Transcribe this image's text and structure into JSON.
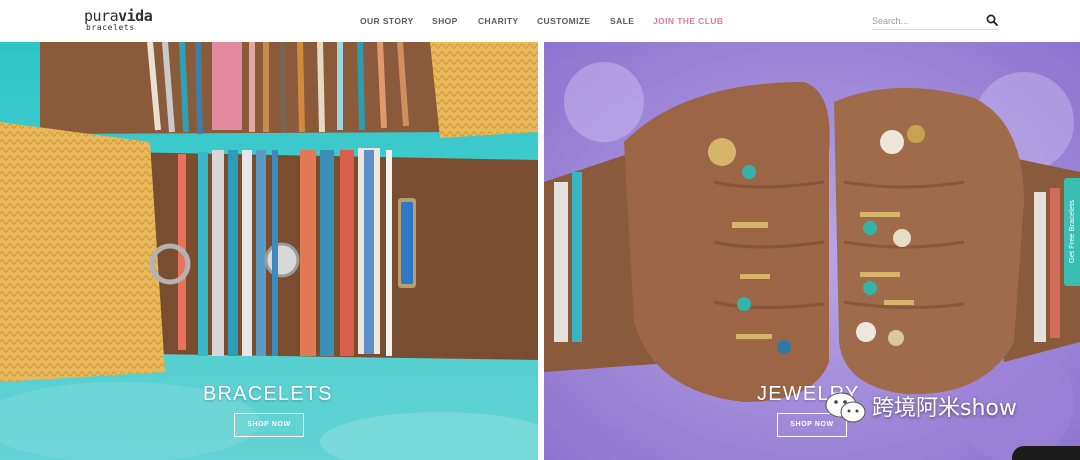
{
  "brand": {
    "name_light": "pura",
    "name_bold": "vida",
    "tagline": "bracelets"
  },
  "nav": {
    "items": [
      {
        "label": "OUR STORY"
      },
      {
        "label": "SHOP"
      },
      {
        "label": "CHARITY"
      },
      {
        "label": "CUSTOMIZE"
      },
      {
        "label": "SALE"
      },
      {
        "label": "JOIN THE CLUB"
      }
    ]
  },
  "search": {
    "placeholder": "Search..."
  },
  "panels": [
    {
      "title": "BRACELETS",
      "button": "SHOP NOW"
    },
    {
      "title": "JEWELRY",
      "button": "SHOP NOW"
    }
  ],
  "side_tab": {
    "label": "Get Free Bracelets"
  },
  "watermark": {
    "text": "跨境阿米show"
  },
  "colors": {
    "accent_pink": "#e07aa0",
    "teal": "#39bfb2",
    "nav_text": "#5a5a5a"
  }
}
